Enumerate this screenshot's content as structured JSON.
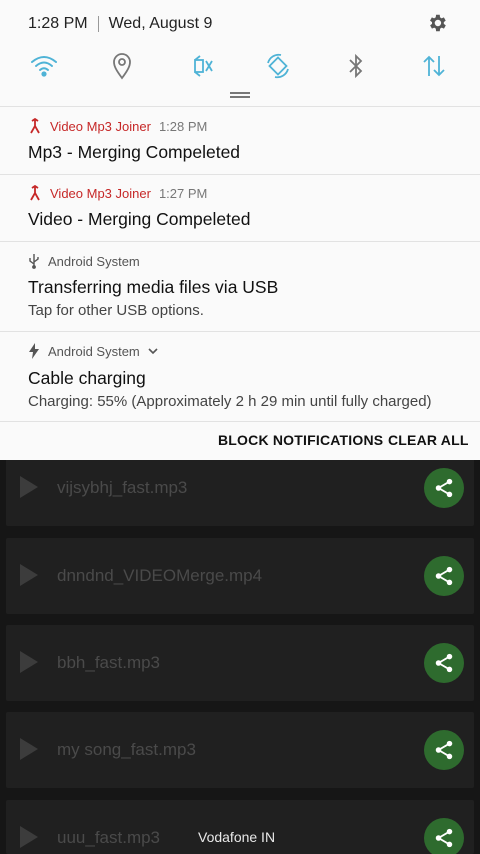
{
  "status": {
    "time": "1:28 PM",
    "date": "Wed, August 9"
  },
  "quick_settings": [
    "wifi-icon",
    "location-icon",
    "sound-mute-icon",
    "auto-rotate-icon",
    "bluetooth-icon",
    "mobile-data-icon"
  ],
  "notifications": [
    {
      "app": "Video Mp3 Joiner",
      "time": "1:28 PM",
      "title": "Mp3 - Merging Compeleted"
    },
    {
      "app": "Video Mp3 Joiner",
      "time": "1:27 PM",
      "title": "Video - Merging Compeleted"
    },
    {
      "app": "Android System",
      "title": "Transferring media files via USB",
      "body": "Tap for other USB options."
    },
    {
      "app": "Android System",
      "title": "Cable charging",
      "body": "Charging: 55% (Approximately 2 h 29 min until fully charged)"
    }
  ],
  "actions": {
    "block": "BLOCK NOTIFICATIONS",
    "clear": "CLEAR ALL"
  },
  "files": [
    "vijsybhj_fast.mp3",
    "dnndnd_VIDEOMerge.mp4",
    "bbh_fast.mp3",
    "my song_fast.mp3",
    "uuu_fast.mp3"
  ],
  "carrier": "Vodafone IN",
  "colors": {
    "accent": "#4fb3d6",
    "app_red": "#c62828",
    "share_green": "#2e6b2e"
  }
}
